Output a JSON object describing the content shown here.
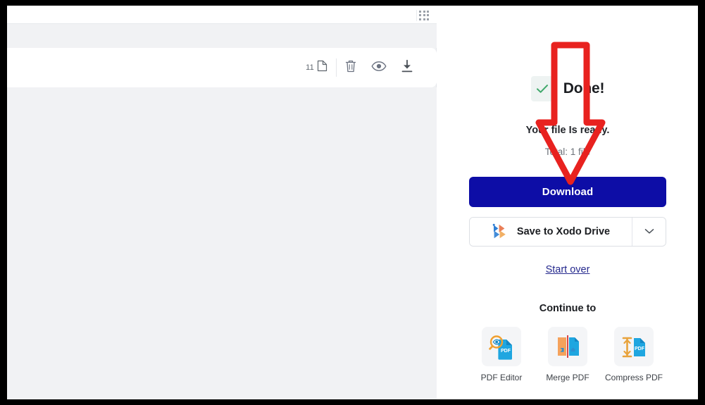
{
  "left_panel": {
    "apps_menu": {
      "icon": "apps-grid-icon",
      "dots": 9
    },
    "file_row": {
      "page_count": "11",
      "page_count_icon": "page-icon",
      "delete_icon": "trash-icon",
      "preview_icon": "eye-icon",
      "download_icon": "download-icon"
    }
  },
  "right_panel": {
    "status_icon": "check-circle-icon",
    "done_title": "Done!",
    "ready_text": "Your file Is ready.",
    "total_text": "Total: 1 file",
    "download_label": "Download",
    "drive_label": "Save to Xodo Drive",
    "drive_icon": "xodo-drive-icon",
    "drive_caret_icon": "chevron-down-icon",
    "start_over_label": "Start over",
    "continue_title": "Continue to",
    "tools": [
      {
        "label": "PDF Editor",
        "icon": "pdf-editor-icon"
      },
      {
        "label": "Merge PDF",
        "icon": "merge-pdf-icon"
      },
      {
        "label": "Compress PDF",
        "icon": "compress-pdf-icon"
      }
    ]
  },
  "annotation": {
    "arrow_icon": "red-down-arrow",
    "arrow_color": "#e8221f"
  },
  "colors": {
    "accent_blue": "#0d0da6",
    "link_blue": "#262a8e",
    "panel_gray": "#f1f2f4",
    "check_green": "#3fa86b",
    "annotation_red": "#e8221f",
    "frame_black": "#000000"
  }
}
